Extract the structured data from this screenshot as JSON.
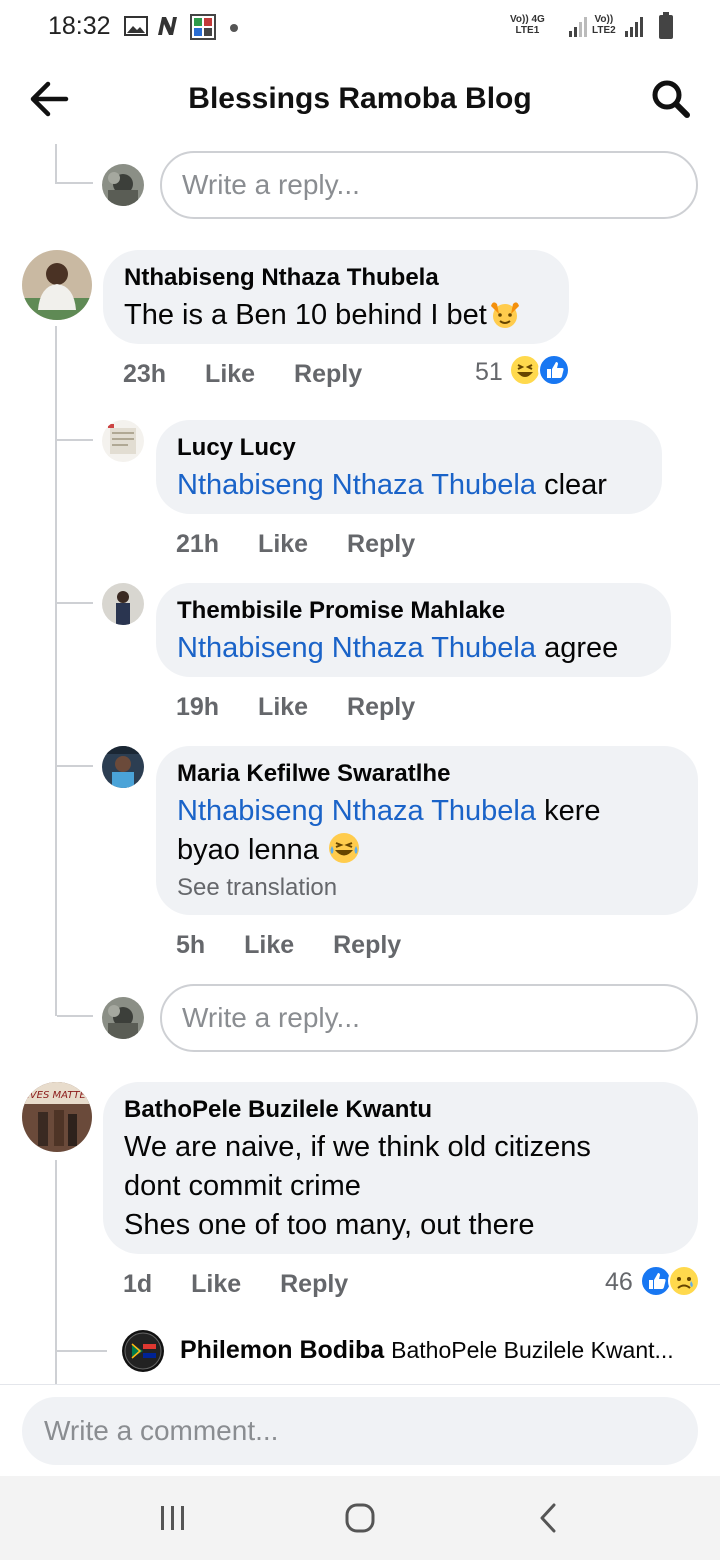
{
  "status": {
    "time": "18:32",
    "net1_top": "Vo)) 4G",
    "net1_bottom": "LTE1",
    "net2_top": "Vo))",
    "net2_bottom": "LTE2"
  },
  "header": {
    "title": "Blessings Ramoba Blog"
  },
  "actions": {
    "like": "Like",
    "reply": "Reply"
  },
  "reply_placeholder": "Write a reply...",
  "comments": [
    {
      "author": "Nthabiseng Nthaza Thubela",
      "text": "The is a Ben 10 behind I bet",
      "time": "23h",
      "reactions": "51"
    },
    {
      "author": "Lucy Lucy",
      "mention": "Nthabiseng Nthaza Thubela",
      "text": "clear",
      "time": "21h"
    },
    {
      "author": "Thembisile Promise Mahlake",
      "mention": "Nthabiseng Nthaza Thubela",
      "text": "agree",
      "time": "19h"
    },
    {
      "author": "Maria Kefilwe Swaratlhe",
      "mention": "Nthabiseng Nthaza Thubela",
      "text_line1": "kere",
      "text_line2": "byao lenna",
      "see_translation": "See translation",
      "time": "5h"
    },
    {
      "author": "BathoPele Buzilele Kwantu",
      "line1": "We are naive, if we think old citizens",
      "line2": "dont commit crime",
      "line3": "Shes one of too many, out there",
      "time": "1d",
      "reactions": "46"
    },
    {
      "author": "Philemon Bodiba",
      "preview": "BathoPele Buzilele Kwant..."
    }
  ],
  "comment_bar": {
    "placeholder": "Write a comment..."
  },
  "icons": {
    "back": "back-arrow-icon",
    "search": "search-icon",
    "laugh": "laughing-emoji-icon",
    "like": "like-thumb-icon",
    "sad": "sad-emoji-icon"
  }
}
